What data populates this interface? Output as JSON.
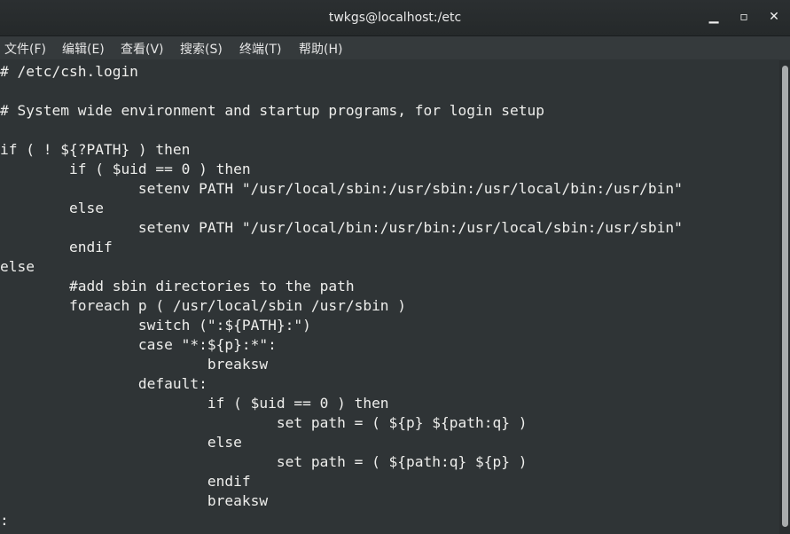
{
  "window": {
    "title": "twkgs@localhost:/etc",
    "minimize_label": "▁",
    "maximize_label": "▫",
    "close_label": "✕"
  },
  "menubar": {
    "file": "文件(F)",
    "edit": "编辑(E)",
    "view": "查看(V)",
    "search": "搜索(S)",
    "terminal": "终端(T)",
    "help": "帮助(H)"
  },
  "terminal": {
    "lines": [
      "# /etc/csh.login",
      "",
      "# System wide environment and startup programs, for login setup",
      "",
      "if ( ! ${?PATH} ) then",
      "        if ( $uid == 0 ) then",
      "                setenv PATH \"/usr/local/sbin:/usr/sbin:/usr/local/bin:/usr/bin\"",
      "        else",
      "                setenv PATH \"/usr/local/bin:/usr/bin:/usr/local/sbin:/usr/sbin\"",
      "        endif",
      "else",
      "        #add sbin directories to the path",
      "        foreach p ( /usr/local/sbin /usr/sbin )",
      "                switch (\":${PATH}:\")",
      "                case \"*:${p}:*\":",
      "                        breaksw",
      "                default:",
      "                        if ( $uid == 0 ) then",
      "                                set path = ( ${p} ${path:q} )",
      "                        else",
      "                                set path = ( ${path:q} ${p} )",
      "                        endif",
      "                        breaksw",
      ":"
    ]
  }
}
